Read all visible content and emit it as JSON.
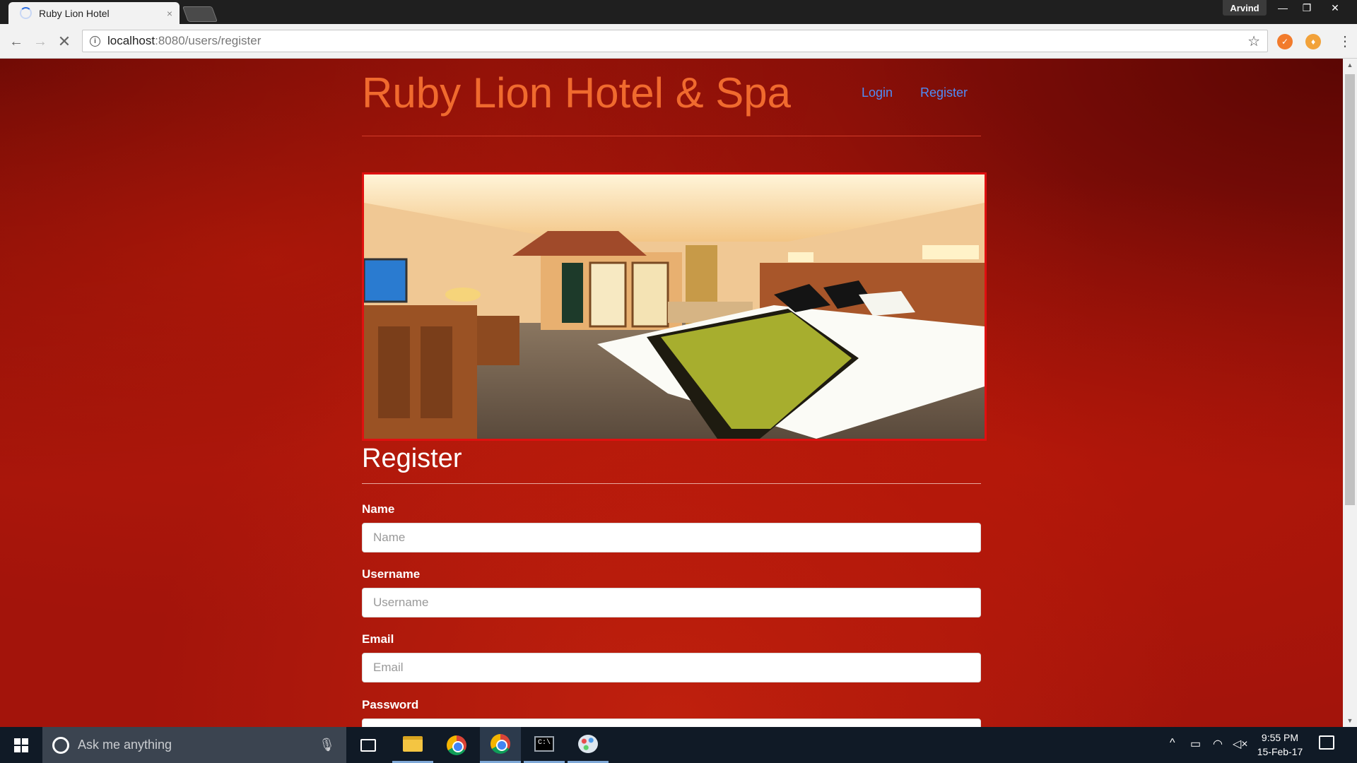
{
  "browser": {
    "tab_title": "Ruby Lion Hotel",
    "tab_close": "×",
    "profile_name": "Arvind",
    "window_controls": {
      "minimize": "—",
      "restore": "❐",
      "close": "✕"
    },
    "url_host": "localhost",
    "url_rest": ":8080/users/register",
    "icons": [
      "back-icon",
      "forward-icon",
      "stop-icon",
      "info-icon",
      "star-icon",
      "extension-icon",
      "menu-icon"
    ]
  },
  "site": {
    "title": "Ruby Lion Hotel & Spa",
    "nav": {
      "login": "Login",
      "register": "Register"
    },
    "colors": {
      "title": "#f06a2e",
      "link": "#4f8cf5",
      "background": "#a3140b",
      "hero_border": "#e01010"
    }
  },
  "form": {
    "heading": "Register",
    "fields": [
      {
        "label": "Name",
        "placeholder": "Name",
        "value": ""
      },
      {
        "label": "Username",
        "placeholder": "Username",
        "value": ""
      },
      {
        "label": "Email",
        "placeholder": "Email",
        "value": ""
      },
      {
        "label": "Password",
        "placeholder": "",
        "value": ""
      }
    ]
  },
  "taskbar": {
    "search_placeholder": "Ask me anything",
    "apps": [
      "task-view-icon",
      "file-explorer-icon",
      "chrome-icon",
      "chrome-icon",
      "command-prompt-icon",
      "paint-icon"
    ],
    "time": "9:55 PM",
    "date": "15-Feb-17"
  }
}
